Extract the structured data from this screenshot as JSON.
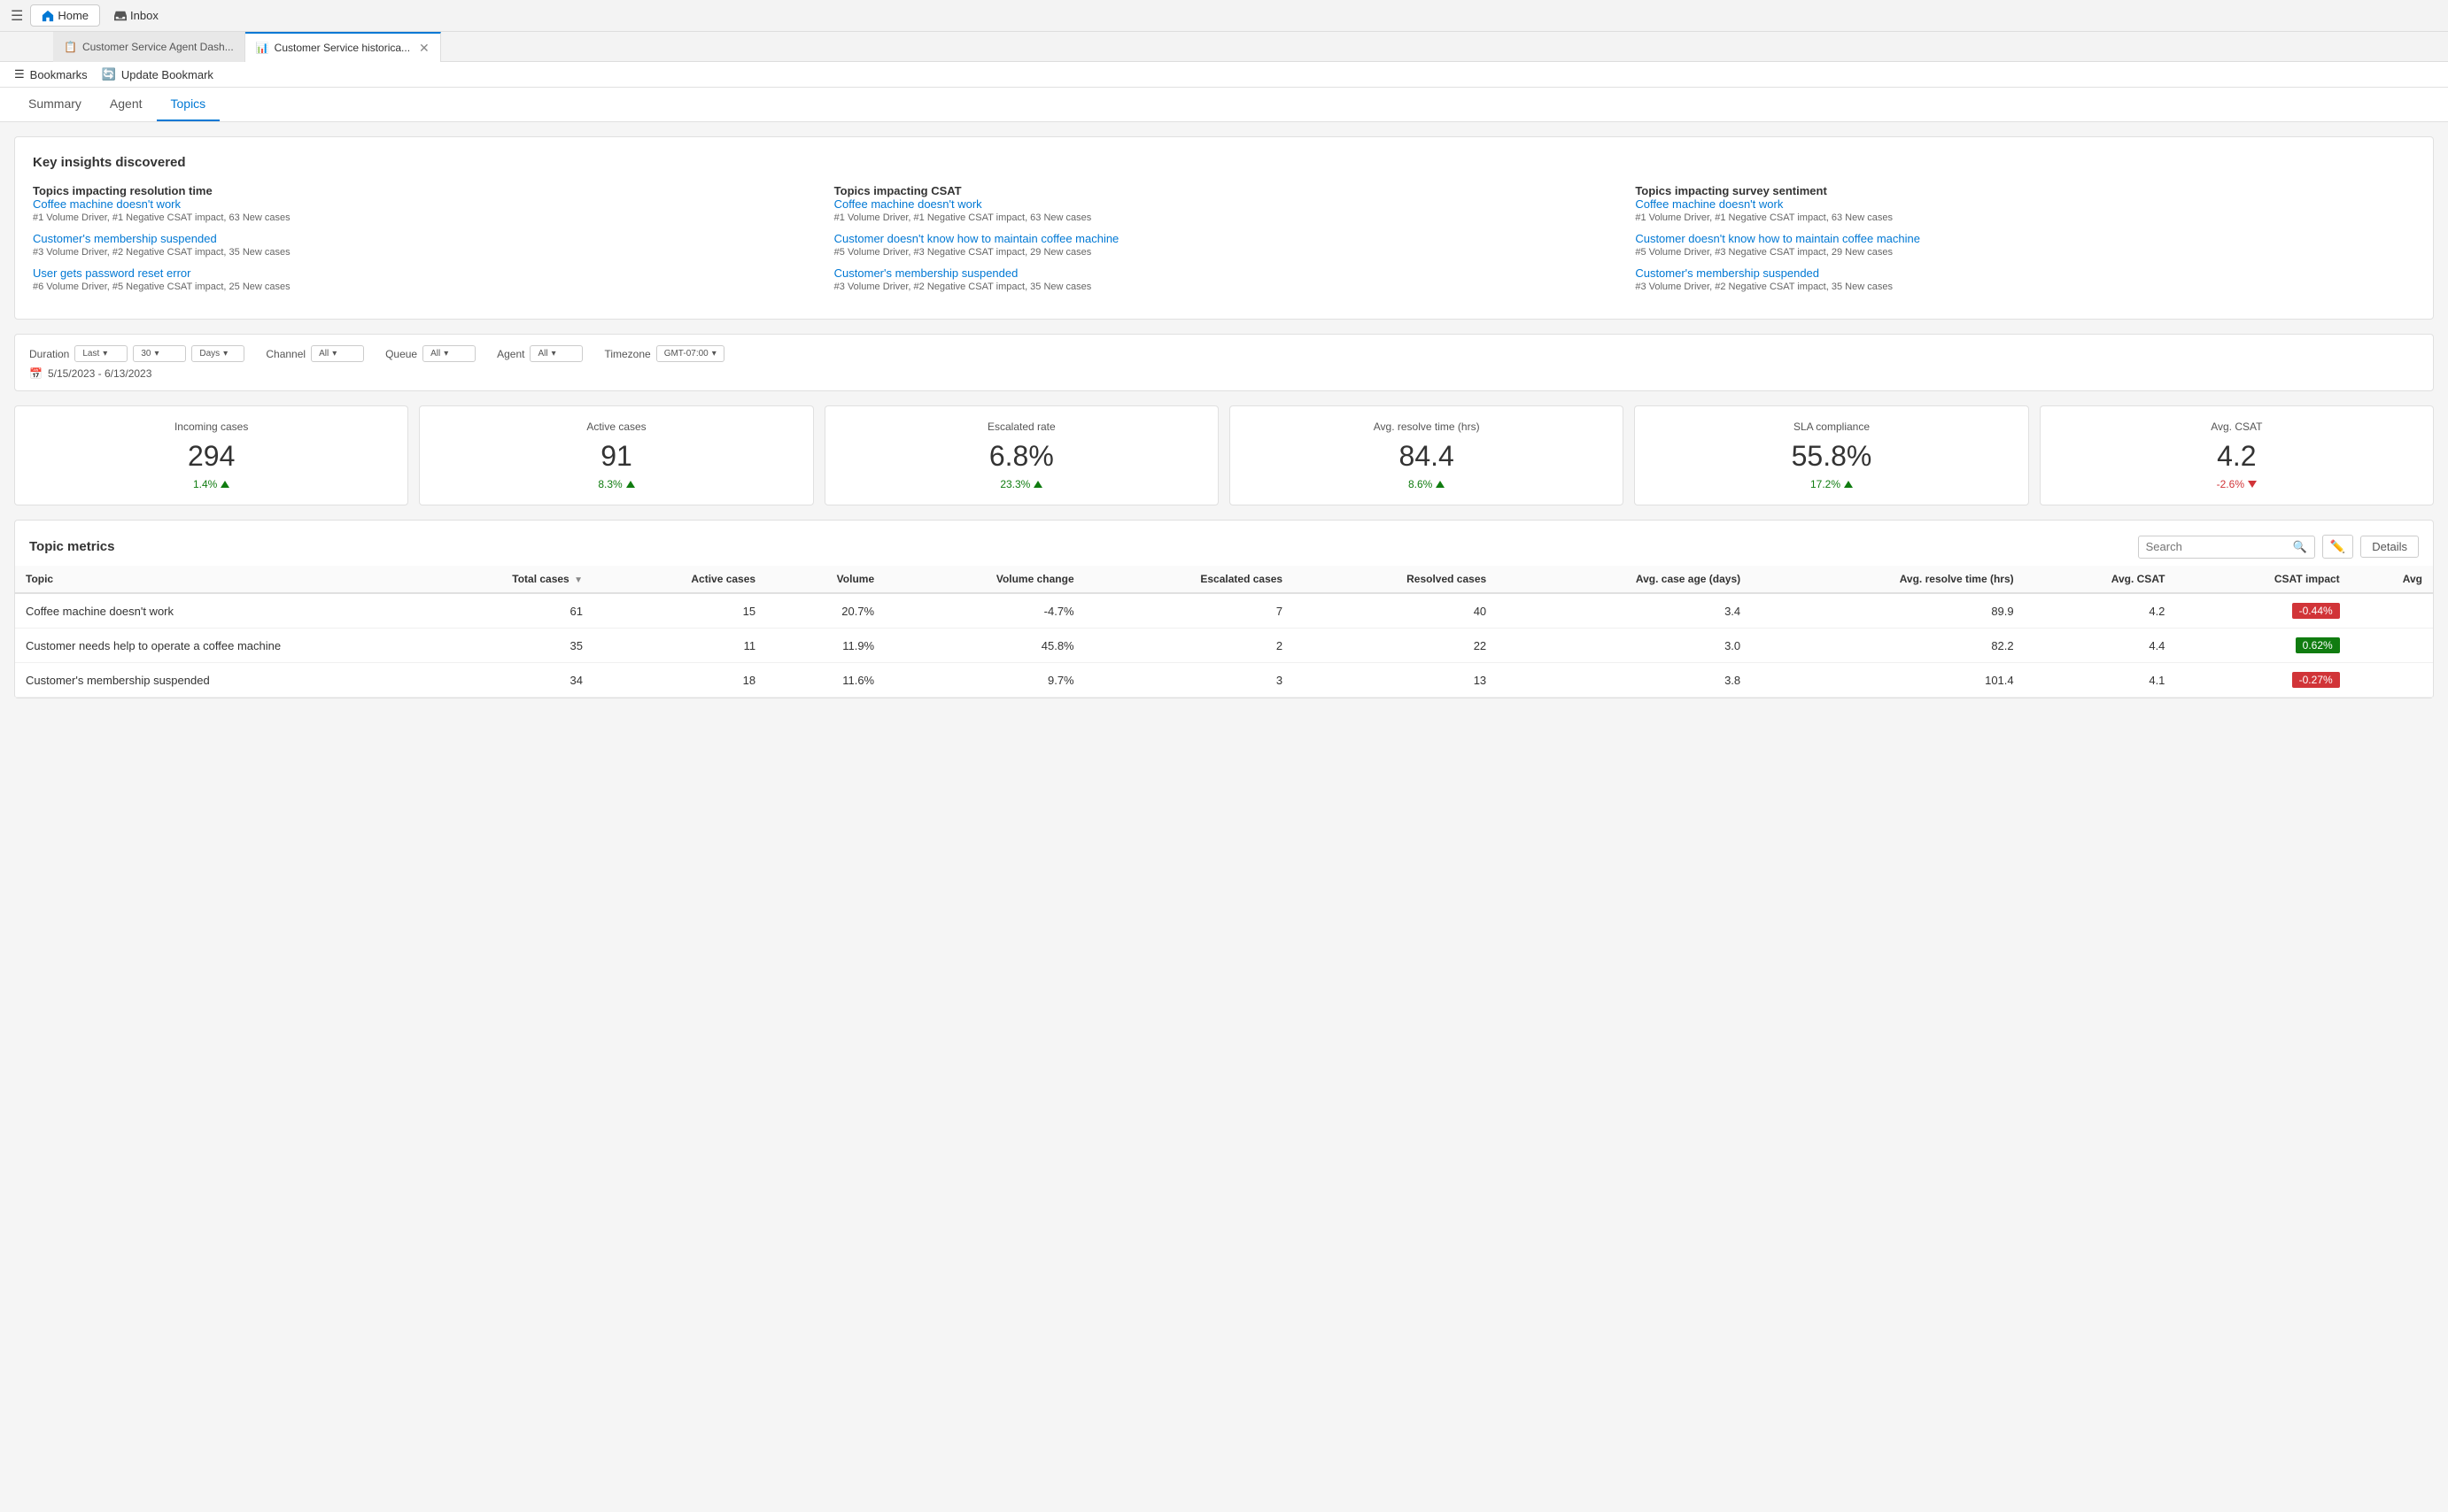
{
  "topbar": {
    "hamburger": "☰",
    "home_label": "Home",
    "inbox_label": "Inbox"
  },
  "tabs": [
    {
      "id": "agent-dash",
      "label": "Customer Service Agent Dash...",
      "icon": "📋",
      "active": false
    },
    {
      "id": "historical",
      "label": "Customer Service historica...",
      "icon": "📊",
      "active": true
    }
  ],
  "bookmarks": {
    "bookmark_label": "Bookmarks",
    "update_label": "Update Bookmark"
  },
  "main_nav": {
    "tabs": [
      {
        "id": "summary",
        "label": "Summary",
        "active": false
      },
      {
        "id": "agent",
        "label": "Agent",
        "active": false
      },
      {
        "id": "topics",
        "label": "Topics",
        "active": true
      }
    ]
  },
  "insights": {
    "title": "Key insights discovered",
    "columns": [
      {
        "heading": "Topics impacting resolution time",
        "items": [
          {
            "link": "Coffee machine doesn't work",
            "meta": "#1 Volume Driver, #1 Negative CSAT impact, 63 New cases"
          },
          {
            "link": "Customer's membership suspended",
            "meta": "#3 Volume Driver, #2 Negative CSAT impact, 35 New cases"
          },
          {
            "link": "User gets password reset error",
            "meta": "#6 Volume Driver, #5 Negative CSAT impact, 25 New cases"
          }
        ]
      },
      {
        "heading": "Topics impacting CSAT",
        "items": [
          {
            "link": "Coffee machine doesn't work",
            "meta": "#1 Volume Driver, #1 Negative CSAT impact, 63 New cases"
          },
          {
            "link": "Customer doesn't know how to maintain coffee machine",
            "meta": "#5 Volume Driver, #3 Negative CSAT impact, 29 New cases"
          },
          {
            "link": "Customer's membership suspended",
            "meta": "#3 Volume Driver, #2 Negative CSAT impact, 35 New cases"
          }
        ]
      },
      {
        "heading": "Topics impacting survey sentiment",
        "items": [
          {
            "link": "Coffee machine doesn't work",
            "meta": "#1 Volume Driver, #1 Negative CSAT impact, 63 New cases"
          },
          {
            "link": "Customer doesn't know how to maintain coffee machine",
            "meta": "#5 Volume Driver, #3 Negative CSAT impact, 29 New cases"
          },
          {
            "link": "Customer's membership suspended",
            "meta": "#3 Volume Driver, #2 Negative CSAT impact, 35 New cases"
          }
        ]
      }
    ]
  },
  "filters": {
    "duration_label": "Duration",
    "duration_value": "Last",
    "duration_num": "30",
    "duration_unit": "Days",
    "channel_label": "Channel",
    "channel_value": "All",
    "queue_label": "Queue",
    "queue_value": "All",
    "agent_label": "Agent",
    "agent_value": "All",
    "timezone_label": "Timezone",
    "timezone_value": "GMT-07:00",
    "date_range": "5/15/2023 - 6/13/2023",
    "calendar_icon": "📅"
  },
  "kpis": [
    {
      "id": "incoming",
      "title": "Incoming cases",
      "value": "294",
      "change": "1.4%",
      "direction": "up"
    },
    {
      "id": "active",
      "title": "Active cases",
      "value": "91",
      "change": "8.3%",
      "direction": "up"
    },
    {
      "id": "escalated",
      "title": "Escalated rate",
      "value": "6.8%",
      "change": "23.3%",
      "direction": "up"
    },
    {
      "id": "resolve-time",
      "title": "Avg. resolve time (hrs)",
      "value": "84.4",
      "change": "8.6%",
      "direction": "up"
    },
    {
      "id": "sla",
      "title": "SLA compliance",
      "value": "55.8%",
      "change": "17.2%",
      "direction": "up"
    },
    {
      "id": "csat",
      "title": "Avg. CSAT",
      "value": "4.2",
      "change": "-2.6%",
      "direction": "down"
    }
  ],
  "topic_metrics": {
    "title": "Topic metrics",
    "search_placeholder": "Search",
    "details_label": "Details",
    "columns": [
      {
        "id": "topic",
        "label": "Topic"
      },
      {
        "id": "total",
        "label": "Total cases",
        "sortable": true
      },
      {
        "id": "active",
        "label": "Active cases"
      },
      {
        "id": "volume",
        "label": "Volume"
      },
      {
        "id": "vol-change",
        "label": "Volume change"
      },
      {
        "id": "escalated",
        "label": "Escalated cases"
      },
      {
        "id": "resolved",
        "label": "Resolved cases"
      },
      {
        "id": "case-age",
        "label": "Avg. case age (days)"
      },
      {
        "id": "resolve-time",
        "label": "Avg. resolve time (hrs)"
      },
      {
        "id": "avg-csat",
        "label": "Avg. CSAT"
      },
      {
        "id": "csat-impact",
        "label": "CSAT impact"
      },
      {
        "id": "avg2",
        "label": "Avg"
      }
    ],
    "rows": [
      {
        "topic": "Coffee machine doesn't work",
        "total": "61",
        "active": "15",
        "volume": "20.7%",
        "vol_change": "-4.7%",
        "escalated": "7",
        "resolved": "40",
        "case_age": "3.4",
        "resolve_time": "89.9",
        "avg_csat": "4.2",
        "csat_impact": "-0.44%",
        "csat_impact_type": "negative",
        "avg2": ""
      },
      {
        "topic": "Customer needs help to operate a coffee machine",
        "total": "35",
        "active": "11",
        "volume": "11.9%",
        "vol_change": "45.8%",
        "escalated": "2",
        "resolved": "22",
        "case_age": "3.0",
        "resolve_time": "82.2",
        "avg_csat": "4.4",
        "csat_impact": "0.62%",
        "csat_impact_type": "positive",
        "avg2": ""
      },
      {
        "topic": "Customer's membership suspended",
        "total": "34",
        "active": "18",
        "volume": "11.6%",
        "vol_change": "9.7%",
        "escalated": "3",
        "resolved": "13",
        "case_age": "3.8",
        "resolve_time": "101.4",
        "avg_csat": "4.1",
        "csat_impact": "-0.27%",
        "csat_impact_type": "negative",
        "avg2": ""
      }
    ]
  }
}
